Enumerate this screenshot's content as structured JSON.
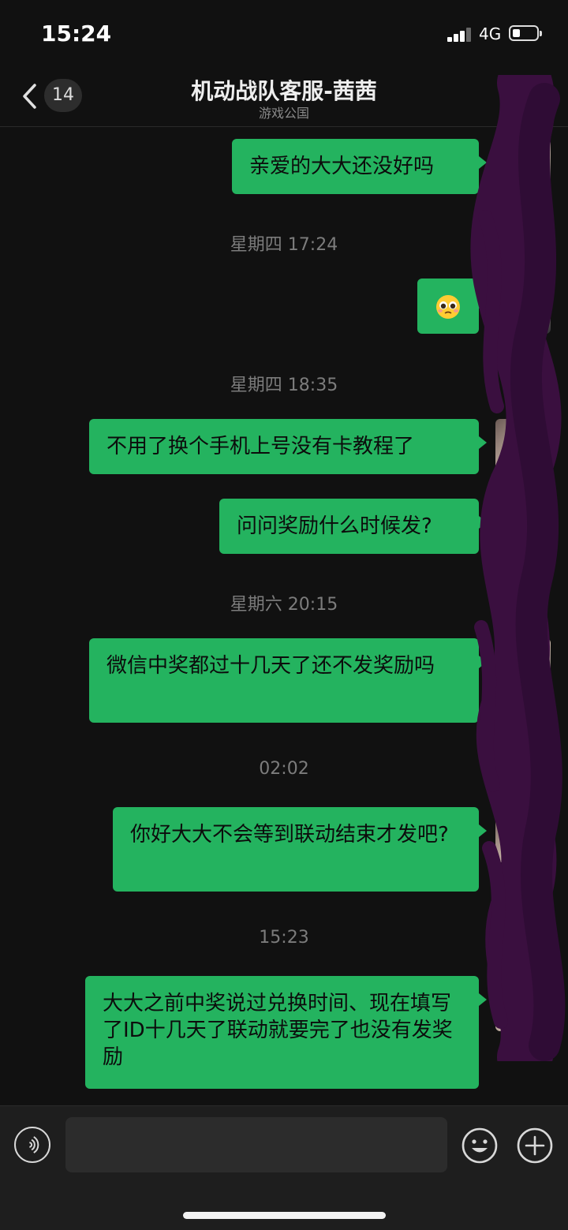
{
  "status_bar": {
    "time": "15:24",
    "network": "4G",
    "icons": [
      "signal-icon",
      "battery-icon"
    ]
  },
  "header": {
    "unread_count": "14",
    "title": "机动战队客服-茜茜",
    "subtitle": "游戏公国",
    "icons": [
      "back-chevron-icon",
      "more-icon"
    ]
  },
  "messages": [
    {
      "type": "outgoing",
      "text": "亲爱的大大还没好吗"
    },
    {
      "type": "timestamp",
      "text": "星期四 17:24"
    },
    {
      "type": "outgoing",
      "emoji": "pleading-face-icon"
    },
    {
      "type": "timestamp",
      "text": "星期四 18:35"
    },
    {
      "type": "outgoing",
      "text": "不用了换个手机上号没有卡教程了"
    },
    {
      "type": "outgoing",
      "text": "问问奖励什么时候发?"
    },
    {
      "type": "timestamp",
      "text": "星期六 20:15"
    },
    {
      "type": "outgoing",
      "text": "微信中奖都过十几天了还不发奖励吗"
    },
    {
      "type": "timestamp",
      "text": "02:02"
    },
    {
      "type": "outgoing",
      "text": "你好大大不会等到联动结束才发吧?"
    },
    {
      "type": "timestamp",
      "text": "15:23"
    },
    {
      "type": "outgoing",
      "text": "大大之前中奖说过兑换时间、现在填写了ID十几天了联动就要完了也没有发奖励"
    }
  ],
  "input_bar": {
    "message_value": "",
    "icons": [
      "voice-icon",
      "emoji-icon",
      "plus-icon"
    ]
  },
  "colors": {
    "bubble": "#24b35f",
    "background": "#111111",
    "redaction": "#3a0f3f"
  }
}
